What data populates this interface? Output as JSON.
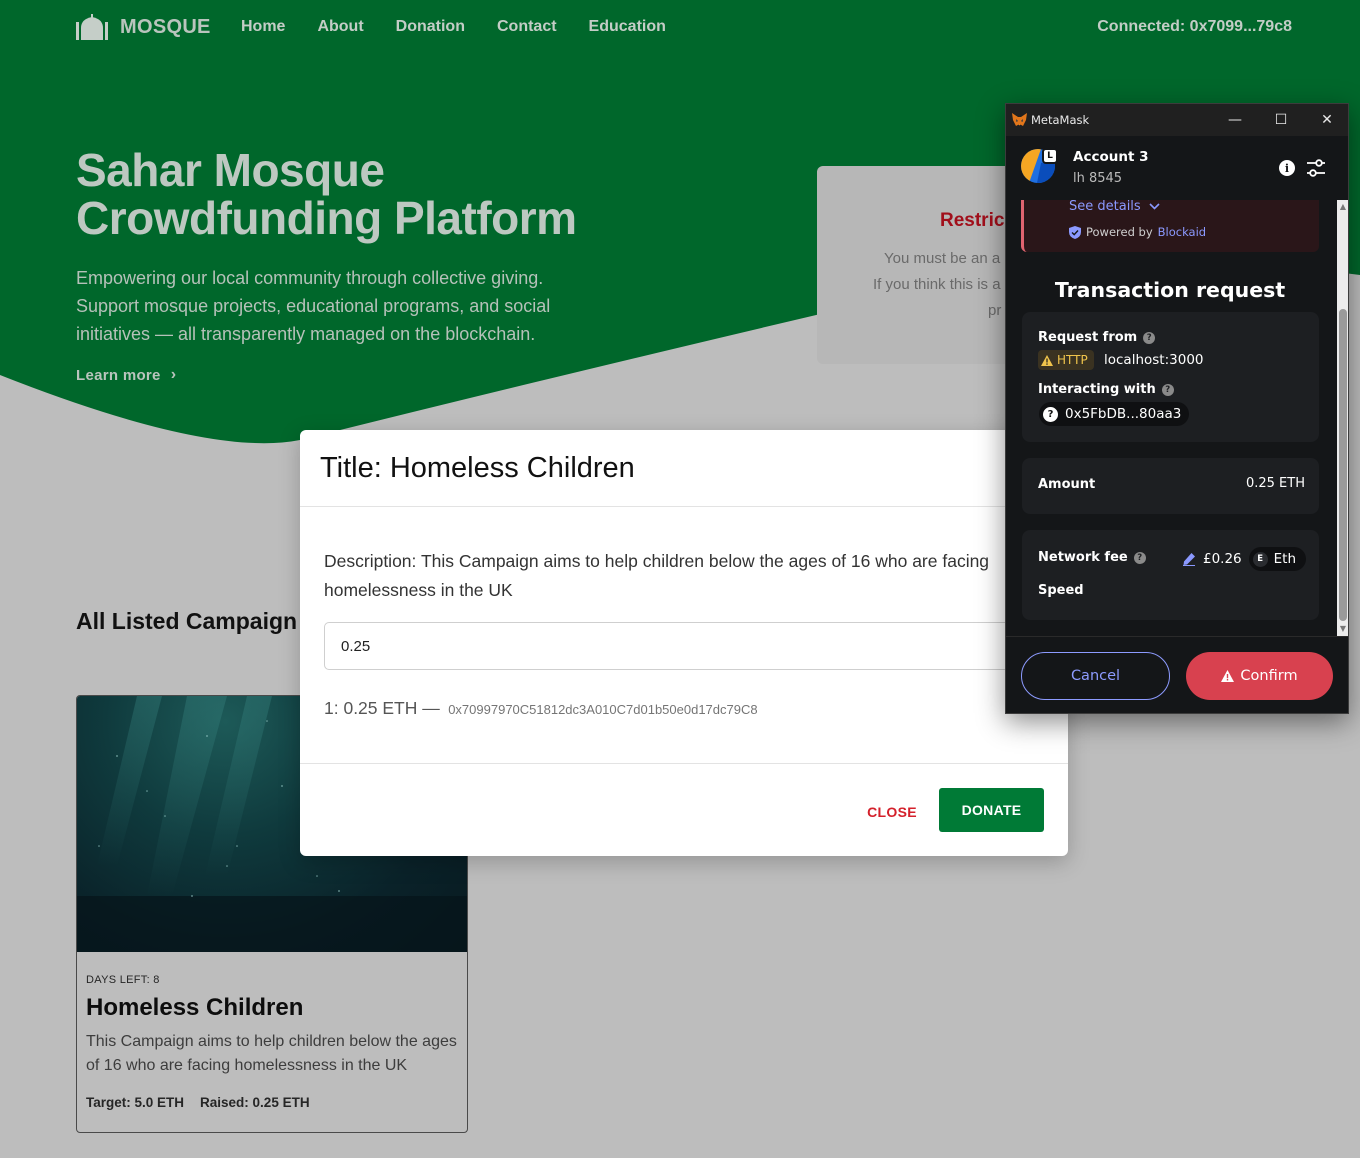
{
  "navbar": {
    "brand": "MOSQUE",
    "links": [
      "Home",
      "About",
      "Donation",
      "Contact",
      "Education"
    ],
    "connected": "Connected: 0x7099...79c8"
  },
  "hero": {
    "title": "Sahar Mosque Crowdfunding Platform",
    "subtitle": "Empowering our local community through collective giving. Support mosque projects, educational programs, and social initiatives — all transparently managed on the blockchain.",
    "learn_more": "Learn more"
  },
  "restricted_card": {
    "title": "Restric",
    "line1": "You must be an a",
    "line2": "If you think this is a",
    "line3": "pr"
  },
  "campaigns": {
    "section_title": "All Listed Campaign",
    "items": [
      {
        "days_left": "DAYS LEFT: 8",
        "title": "Homeless Children",
        "description": "This Campaign aims to help children below the ages of 16 who are facing homelessness in the UK",
        "target": "Target: 5.0 ETH",
        "raised": "Raised: 0.25 ETH"
      }
    ]
  },
  "modal": {
    "title": "Title: Homeless Children",
    "description": "Description: This Campaign aims to help children below the ages of 16 who are facing homelessness in the UK",
    "input_value": "0.25",
    "donor_amount": "1: 0.25 ETH —",
    "donor_address": "0x70997970C51812dc3A010C7d01b50e0d17dc79C8",
    "close_label": "CLOSE",
    "donate_label": "DONATE"
  },
  "metamask": {
    "app_name": "MetaMask",
    "account_name": "Account 3",
    "network": "lh 8545",
    "avatar_badge": "L",
    "see_details": "See details",
    "powered_by": "Powered by",
    "powered_by_link": "Blockaid",
    "tx_title": "Transaction request",
    "request_from_label": "Request from",
    "http_tag": "HTTP",
    "origin": "localhost:3000",
    "interacting_label": "Interacting with",
    "contract_address": "0x5FbDB...80aa3",
    "amount_label": "Amount",
    "amount_value": "0.25 ETH",
    "network_fee_label": "Network fee",
    "network_fee_value": "£0.26",
    "fee_token": "Eth",
    "fee_token_badge": "E",
    "speed_label": "Speed",
    "cancel_label": "Cancel",
    "confirm_label": "Confirm"
  },
  "colors": {
    "hero_green_dimmed": "#00672b",
    "donate_green": "#007a36",
    "close_red": "#d4202b",
    "mm_confirm": "#d8414f",
    "mm_accent": "#8b99ff"
  }
}
